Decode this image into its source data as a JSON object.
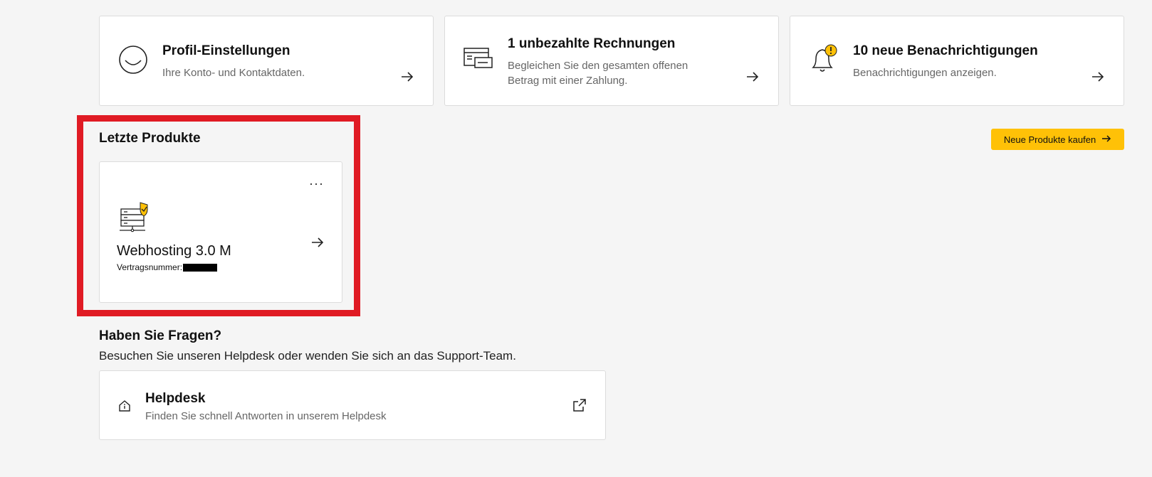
{
  "cards": [
    {
      "title": "Profil-Einstellungen",
      "subtitle": "Ihre Konto- und Kontaktdaten.",
      "icon": "smile-icon"
    },
    {
      "title": "1 unbezahlte Rechnungen",
      "subtitle_line1": "Begleichen Sie den gesamten offenen",
      "subtitle_line2": "Betrag mit einer Zahlung.",
      "icon": "invoice-card-icon"
    },
    {
      "title": "10 neue Benachrichtigungen",
      "subtitle": "Benachrichtigungen anzeigen.",
      "icon": "bell-alert-icon"
    }
  ],
  "products": {
    "heading": "Letzte Produkte",
    "buy_button": "Neue Produkte kaufen",
    "item": {
      "name": "Webhosting 3.0 M",
      "contract_label": "Vertragsnummer:",
      "menu": "···",
      "icon": "server-shield-icon"
    }
  },
  "help": {
    "heading": "Haben Sie Fragen?",
    "subtitle": "Besuchen Sie unseren Helpdesk oder wenden Sie sich an das Support-Team.",
    "card_title": "Helpdesk",
    "card_subtitle": "Finden Sie schnell Antworten in unserem Helpdesk"
  },
  "colors": {
    "accent": "#ffc107",
    "highlight": "#e01b24",
    "background": "#f5f5f5"
  }
}
